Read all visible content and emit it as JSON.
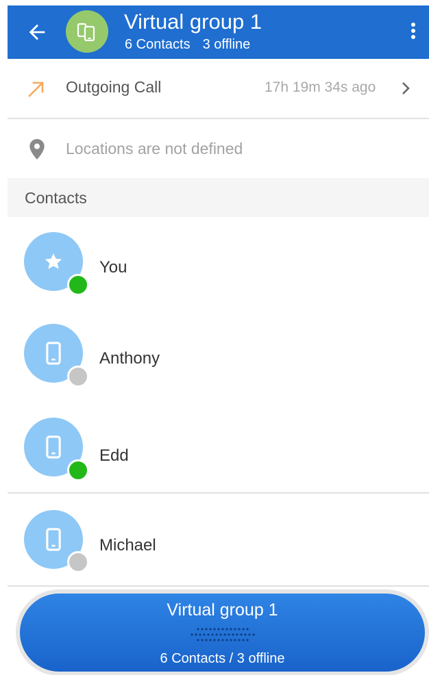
{
  "header": {
    "title": "Virtual group 1",
    "contacts_count": "6 Contacts",
    "offline_count": "3 offline",
    "back_icon": "arrow-left-icon",
    "menu_icon": "more-vertical-icon",
    "bg_color": "#1f6ed0"
  },
  "last_call": {
    "label": "Outgoing Call",
    "time_ago": "17h 19m 34s ago",
    "icon": "outgoing-call-arrow-icon",
    "icon_color": "#f7a95e"
  },
  "location": {
    "label": "Locations are not defined",
    "icon": "location-pin-icon"
  },
  "contacts_section": {
    "label": "Contacts"
  },
  "contacts": [
    {
      "name": "You",
      "icon": "star-icon",
      "status": "online"
    },
    {
      "name": "Anthony",
      "icon": "phone-device-icon",
      "status": "offline"
    },
    {
      "name": "Edd",
      "icon": "phone-device-icon",
      "status": "online"
    },
    {
      "name": "Michael",
      "icon": "phone-device-icon",
      "status": "offline"
    }
  ],
  "bottom_bar": {
    "title": "Virtual group 1",
    "subtitle": "6 Contacts / 3 offline"
  },
  "colors": {
    "accent": "#1f6ed0",
    "group_avatar": "#95c96c",
    "contact_avatar": "#8ec8f6",
    "online": "#22b81a",
    "offline": "#c6c6c6"
  }
}
